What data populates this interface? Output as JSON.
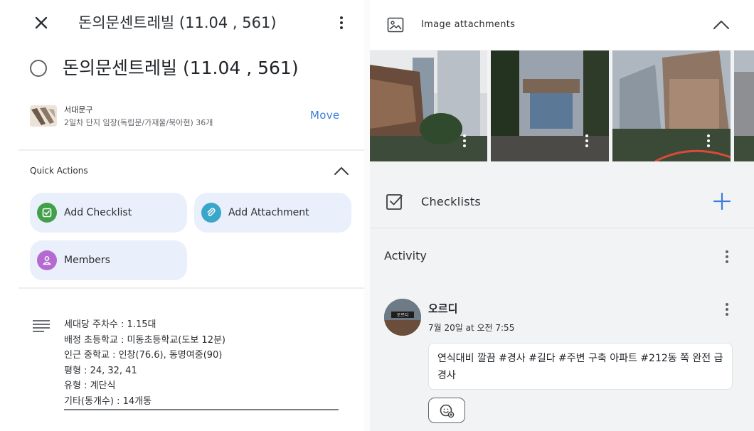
{
  "header": {
    "title": "돈의문센트레빌 (11.04 , 561)",
    "close_icon": "close-icon",
    "menu_icon": "more-vert-icon"
  },
  "card": {
    "title": "돈의문센트레빌 (11.04 , 561)",
    "board_name": "서대문구",
    "list_name": "2일차 단지 임장(독립문/가재울/북아현) 36개",
    "move_label": "Move"
  },
  "quick_actions": {
    "label": "Quick Actions",
    "buttons": [
      {
        "label": "Add Checklist",
        "icon": "checklist-icon",
        "color": "#43a04a"
      },
      {
        "label": "Add Attachment",
        "icon": "paperclip-icon",
        "color": "#3aa6c9"
      },
      {
        "label": "Members",
        "icon": "person-icon",
        "color": "#b46ad1"
      }
    ]
  },
  "description": {
    "icon": "notes-icon",
    "lines": [
      "세대당 주차수 : 1.15대",
      "배정 초등학교 : 미동초등학교(도보 12분)",
      "인근 중학교 : 인창(76.6), 동명여중(90)",
      "평형 : 24, 32, 41",
      "유형 : 계단식",
      "기타(동개수) : 14개동"
    ]
  },
  "attachments": {
    "label": "Image attachments",
    "icon": "image-icon"
  },
  "checklists": {
    "label": "Checklists",
    "icon": "checkbox-icon",
    "add_icon": "plus-icon"
  },
  "activity": {
    "label": "Activity",
    "comment": {
      "user": "오르디",
      "avatar_text": "오르디",
      "time": "7월 20일 at 오전 7:55",
      "text": "연식대비 깔끔 #경사 #길다 #주변 구축 아파트 #212동 쪽 완전 급경사",
      "reaction_icon": "add-reaction-icon"
    }
  },
  "colors": {
    "accent": "#3b7ddd",
    "chip_bg": "#e9effb",
    "panel_bg": "#f2f3f5"
  }
}
